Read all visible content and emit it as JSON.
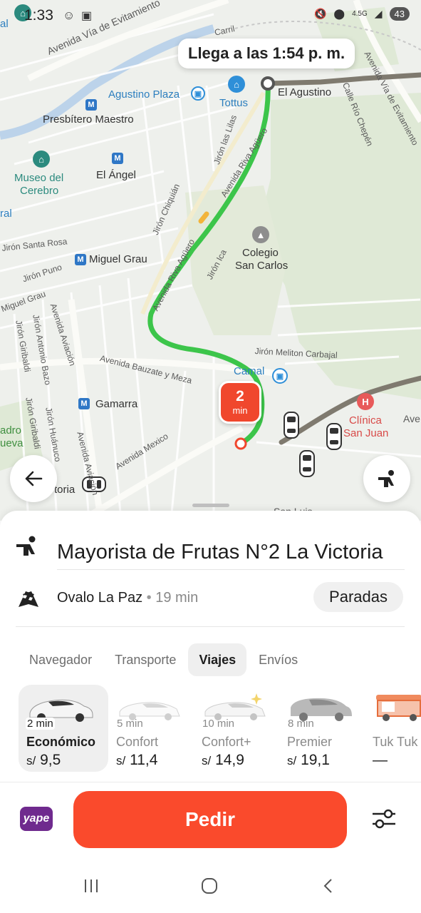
{
  "status_bar": {
    "time": "1:33",
    "network": "4.5G",
    "battery": "43"
  },
  "map": {
    "arrival_tooltip": "Llega a las 1:54 p. m.",
    "eta_badge": {
      "value": "2",
      "unit": "min"
    },
    "labels": {
      "el_agustino": "El Agustino",
      "agustino_plaza": "Agustino Plaza",
      "tottus": "Tottus",
      "presbitero_maestro": "Presbítero Maestro",
      "museo_line1": "Museo del",
      "museo_line2": "Cerebro",
      "el_angel": "El Ángel",
      "miguel_grau": "Miguel Grau",
      "colegio_line1": "Colegio",
      "colegio_line2": "San Carlos",
      "gamarra": "Gamarra",
      "camal": "Camal",
      "clinica_line1": "Clínica",
      "clinica_line2": "San Juan",
      "av_via_evitamiento": "Avenida Vía de Evitamiento",
      "av_via_evitamiento_right": "Avenida Vía de Evitamiento",
      "av_riva_aguero": "Avenida Riva Agüero",
      "av_riva_aguero_lower": "Avenida Riva Agüero",
      "jiron_las_lilas": "Jirón las Lilas",
      "jiron_chiquian": "Jirón Chiquián",
      "jiron_ica": "Jirón Ica",
      "jiron_santa_rosa": "Jirón Santa Rosa",
      "jiron_puno": "Jirón Puno",
      "miguel_grau_street": "Miguel Grau",
      "jiron_melitón": "Jirón Meliton Carbajal",
      "av_bauzate": "Avenida Bauzate y Meza",
      "av_aviacion": "Avenida Aviación",
      "av_aviacion_lower": "Avenida Aviación",
      "jiron_antonio_bazo": "Jirón Antonio Bazo",
      "jiron_giribaldi": "Jirón Giribaldi",
      "jiron_giribaldi_2": "Jirón Giribaldi",
      "jiron_huanuco": "Jirón Huánuco",
      "av_mexico": "Avenida Mexico",
      "calle_rio_chepen": "Calle Río Chepén",
      "carrill": "Carril",
      "san_luis": "San Luis",
      "victoria_frag": "toria",
      "edge_ral": "ral",
      "edge_adro": "adro",
      "edge_ueva": "ueva",
      "edge_al": "al",
      "edge_ave": "Ave"
    }
  },
  "sheet": {
    "destination": "Mayorista de Frutas N°2 La Victoria",
    "stop": {
      "name": "Ovalo La Paz",
      "separator": "•",
      "duration": "19 min"
    },
    "stops_button": "Paradas",
    "tabs": [
      {
        "label": "Navegador",
        "active": false
      },
      {
        "label": "Transporte",
        "active": false
      },
      {
        "label": "Viajes",
        "active": true
      },
      {
        "label": "Envíos",
        "active": false
      }
    ],
    "tariffs": [
      {
        "eta": "2 min",
        "name": "Económico",
        "currency": "s/",
        "price": "9,5",
        "active": true
      },
      {
        "eta": "5 min",
        "name": "Confort",
        "currency": "s/",
        "price": "11,4",
        "active": false
      },
      {
        "eta": "10 min",
        "name": "Confort+",
        "currency": "s/",
        "price": "14,9",
        "active": false
      },
      {
        "eta": "8 min",
        "name": "Premier",
        "currency": "s/",
        "price": "19,1",
        "active": false
      },
      {
        "eta": "",
        "name": "Tuk Tuk",
        "currency": "",
        "price": "—",
        "active": false
      }
    ]
  },
  "bottom": {
    "payment_label": "yape",
    "order_button": "Pedir"
  },
  "colors": {
    "accent": "#fa4a2c",
    "route": "#3cc54a",
    "route_traveled": "#7f7a6f",
    "yape": "#6f2a8e"
  }
}
